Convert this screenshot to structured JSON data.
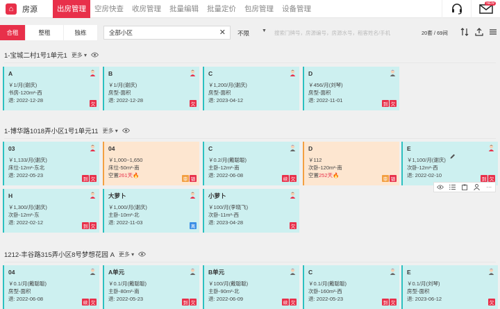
{
  "nav": {
    "brand_title": "房源",
    "tabs": [
      {
        "label": "出房管理",
        "active": true
      },
      {
        "label": "空房快查"
      },
      {
        "label": "收房管理"
      },
      {
        "label": "批量编辑"
      },
      {
        "label": "批量定价"
      },
      {
        "label": "包房管理"
      },
      {
        "label": "设备管理"
      }
    ],
    "new_badge": "NEW"
  },
  "toolbar": {
    "modes": [
      "合租",
      "整租",
      "独栋"
    ],
    "area_value": "全部小区",
    "limit_value": "不限",
    "search_placeholder": "搜索门牌号，房源编号，房源水号，租客姓名/手机",
    "count": "20套 / 69间"
  },
  "groups": [
    {
      "title": "1-宝城二村1号1单元1",
      "more": "更多",
      "cards": [
        {
          "name": "A",
          "line1": "￥1/月(谢庆)",
          "line2": "书房-120m²-西",
          "line3": "退: 2022-12-28",
          "tags": [
            [
              "欠",
              "red"
            ]
          ],
          "avatar": "f"
        },
        {
          "name": "B",
          "line1": "￥1/月(谢庆)",
          "line2": "房型-面积",
          "line3": "退: 2022-12-28",
          "tags": [
            [
              "欠",
              "red"
            ]
          ],
          "avatar": "f"
        },
        {
          "name": "C",
          "line1": "￥1,200/月(谢庆)",
          "line2": "房型-面积",
          "line3": "退: 2023-04-12",
          "tags": [],
          "avatar": "f"
        },
        {
          "name": "D",
          "line1": "￥456/月(刘琴)",
          "line2": "房型-面积",
          "line3": "退: 2022-11-01",
          "tags": [
            [
              "到",
              "red"
            ],
            [
              "欠",
              "red"
            ]
          ],
          "avatar": "m"
        }
      ]
    },
    {
      "title": "1-博华路1018弄小区1号1单元11",
      "more": "更多",
      "cards": [
        {
          "name": "03",
          "line1": "￥1,133/月(谢庆)",
          "line2": "床位-12m²-东北",
          "line3": "退: 2022-05-23",
          "tags": [
            [
              "到",
              "red"
            ],
            [
              "欠",
              "red"
            ]
          ],
          "avatar": "f"
        },
        {
          "name": "04",
          "line1": "￥1,000~1,650",
          "line2": "床位-50m²-南",
          "vacant": [
            "空置",
            "261天"
          ],
          "tags": [
            [
              "审",
              "amber"
            ],
            [
              "锁",
              "red"
            ]
          ],
          "orange": true
        },
        {
          "name": "C",
          "line1": "￥0.2/月(戴聪聪)",
          "line2": "主卧-12m²-南",
          "line3": "退: 2022-06-08",
          "tags": [
            [
              "续",
              "red"
            ],
            [
              "欠",
              "red"
            ]
          ],
          "avatar": "m"
        },
        {
          "name": "D",
          "line1": "￥112",
          "line2": "次卧-120m²-南",
          "vacant": [
            "空置",
            "252天"
          ],
          "tags": [
            [
              "审",
              "amber"
            ],
            [
              "锁",
              "red"
            ]
          ],
          "orange": true
        },
        {
          "name": "E",
          "line1": "￥1,100/月(谢庆)",
          "line2": "次卧-12m²-西",
          "line3": "退: 2022-02-10",
          "tags": [
            [
              "到",
              "red"
            ],
            [
              "欠",
              "red"
            ]
          ],
          "avatar": "f",
          "edit": true
        },
        {
          "name": "H",
          "line1": "￥1,300/月(谢庆)",
          "line2": "次卧-12m²-东",
          "line3": "退: 2022-02-12",
          "tags": [
            [
              "到",
              "red"
            ],
            [
              "欠",
              "red"
            ]
          ],
          "avatar": "f"
        },
        {
          "name": "大萝卜",
          "line1": "￥1,000/月(谢庆)",
          "line2": "主卧-10m²-北",
          "line3": "退: 2022-11-03",
          "tags": [
            [
              "离",
              "blue"
            ]
          ],
          "avatar": "f"
        },
        {
          "name": "小萝卜",
          "line1": "￥100/月(李晓飞)",
          "line2": "次卧-11m²-西",
          "line3": "退: 2023-04-28",
          "tags": [
            [
              "欠",
              "red"
            ]
          ],
          "avatar": "f"
        }
      ]
    },
    {
      "title": "1212-丰谷路315弄小区8号梦想花园 A",
      "more": "更多",
      "cards": [
        {
          "name": "04",
          "line1": "￥0.1/月(戴聪聪)",
          "line2": "房型-面积",
          "line3": "退: 2022-06-08",
          "tags": [
            [
              "续",
              "red"
            ],
            [
              "欠",
              "red"
            ]
          ],
          "avatar": "m"
        },
        {
          "name": "A单元",
          "line1": "￥0.1/月(戴聪聪)",
          "line2": "主卧-80m²-南",
          "line3": "退: 2022-05-23",
          "tags": [
            [
              "到",
              "red"
            ],
            [
              "欠",
              "red"
            ]
          ],
          "avatar": "m"
        },
        {
          "name": "B单元",
          "line1": "￥100/月(戴聪聪)",
          "line2": "主卧-90m²-北",
          "line3": "退: 2022-06-09",
          "tags": [
            [
              "续",
              "red"
            ],
            [
              "欠",
              "red"
            ]
          ],
          "avatar": "m"
        },
        {
          "name": "C",
          "line1": "￥0.1/月(戴聪聪)",
          "line2": "次卧-160m²-西",
          "line3": "退: 2022-05-23",
          "tags": [
            [
              "到",
              "red"
            ],
            [
              "欠",
              "red"
            ]
          ],
          "avatar": "m"
        },
        {
          "name": "E",
          "line1": "￥0.1/月(刘琴)",
          "line2": "房型-面积",
          "line3": "退: 2023-06-12",
          "tags": [
            [
              "欠",
              "red"
            ]
          ],
          "avatar": "m"
        }
      ]
    }
  ]
}
